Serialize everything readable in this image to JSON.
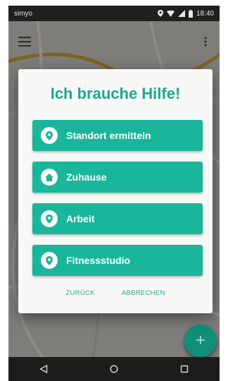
{
  "status_bar": {
    "carrier": "simyo",
    "time": "18:40"
  },
  "dialog": {
    "title": "Ich brauche Hilfe!",
    "options": [
      {
        "label": "Standort ermitteln",
        "icon": "location-pin-icon"
      },
      {
        "label": "Zuhause",
        "icon": "home-icon"
      },
      {
        "label": "Arbeit",
        "icon": "location-pin-icon"
      },
      {
        "label": "Fitnessstudio",
        "icon": "location-pin-icon"
      }
    ],
    "back_label": "ZURÜCK",
    "cancel_label": "ABBRECHEN"
  },
  "fab": {
    "icon": "plus-icon",
    "label": "+"
  },
  "colors": {
    "accent": "#19b69b",
    "title": "#1aa88f",
    "fab": "#0f8f7a"
  }
}
